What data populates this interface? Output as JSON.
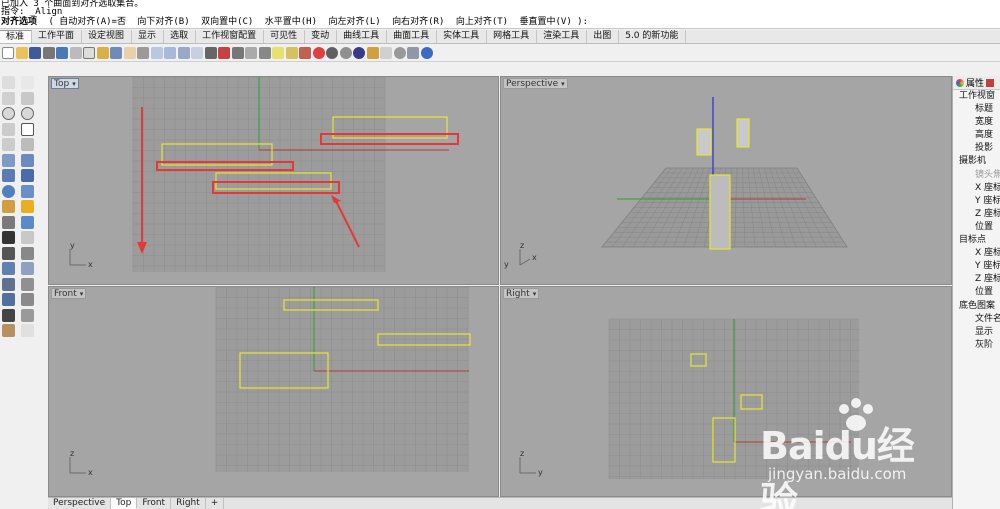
{
  "command": {
    "history_line1": "已加入 3 个曲面到对齐选取集合。",
    "history_line2": "指令: _Align",
    "options_label": "对齐选项",
    "options": [
      "( 自动对齐(A)=否",
      "向下对齐(B)",
      "双向置中(C)",
      "水平置中(H)",
      "向左对齐(L)",
      "向右对齐(R)",
      "向上对齐(T)",
      "垂直置中(V) ):"
    ]
  },
  "toolbar_tabs": [
    "标准",
    "工作平面",
    "设定视图",
    "显示",
    "选取",
    "工作视窗配置",
    "可见性",
    "变动",
    "曲线工具",
    "曲面工具",
    "实体工具",
    "网格工具",
    "渲染工具",
    "出图",
    "5.0 的新功能"
  ],
  "viewports": {
    "top": {
      "label": "Top"
    },
    "perspective": {
      "label": "Perspective"
    },
    "front": {
      "label": "Front"
    },
    "right": {
      "label": "Right"
    }
  },
  "viewport_tabs": [
    "Perspective",
    "Top",
    "Front",
    "Right"
  ],
  "viewport_tabs_add": "+",
  "axis_labels": {
    "x": "x",
    "y": "y",
    "z": "z"
  },
  "properties": {
    "tab_label": "属性",
    "rows": [
      {
        "type": "section",
        "text": "工作视窗"
      },
      {
        "type": "item",
        "text": "标题"
      },
      {
        "type": "item",
        "text": "宽度"
      },
      {
        "type": "item",
        "text": "高度"
      },
      {
        "type": "item",
        "text": "投影"
      },
      {
        "type": "section",
        "text": "摄影机"
      },
      {
        "type": "item-disabled",
        "text": "镜头焦距"
      },
      {
        "type": "item",
        "text": "X 座标"
      },
      {
        "type": "item",
        "text": "Y 座标"
      },
      {
        "type": "item",
        "text": "Z 座标"
      },
      {
        "type": "item",
        "text": "位置"
      },
      {
        "type": "section",
        "text": "目标点"
      },
      {
        "type": "item",
        "text": "X 座标"
      },
      {
        "type": "item",
        "text": "Y 座标"
      },
      {
        "type": "item",
        "text": "Z 座标"
      },
      {
        "type": "item",
        "text": "位置"
      },
      {
        "type": "section",
        "text": "底色图案"
      },
      {
        "type": "item",
        "text": "文件名"
      },
      {
        "type": "item",
        "text": "显示"
      },
      {
        "type": "item",
        "text": "灰阶"
      }
    ]
  },
  "watermark": {
    "brand": "Baidu经验",
    "url": "jingyan.baidu.com"
  },
  "colors": {
    "viewport_bg": "#a5a5a5",
    "grid": "#8e8e8e",
    "object": "#e6e632",
    "annotation": "#e53935",
    "axis_x": "#b23a3a",
    "axis_y": "#2e9e2e",
    "axis_z": "#3030c8"
  }
}
